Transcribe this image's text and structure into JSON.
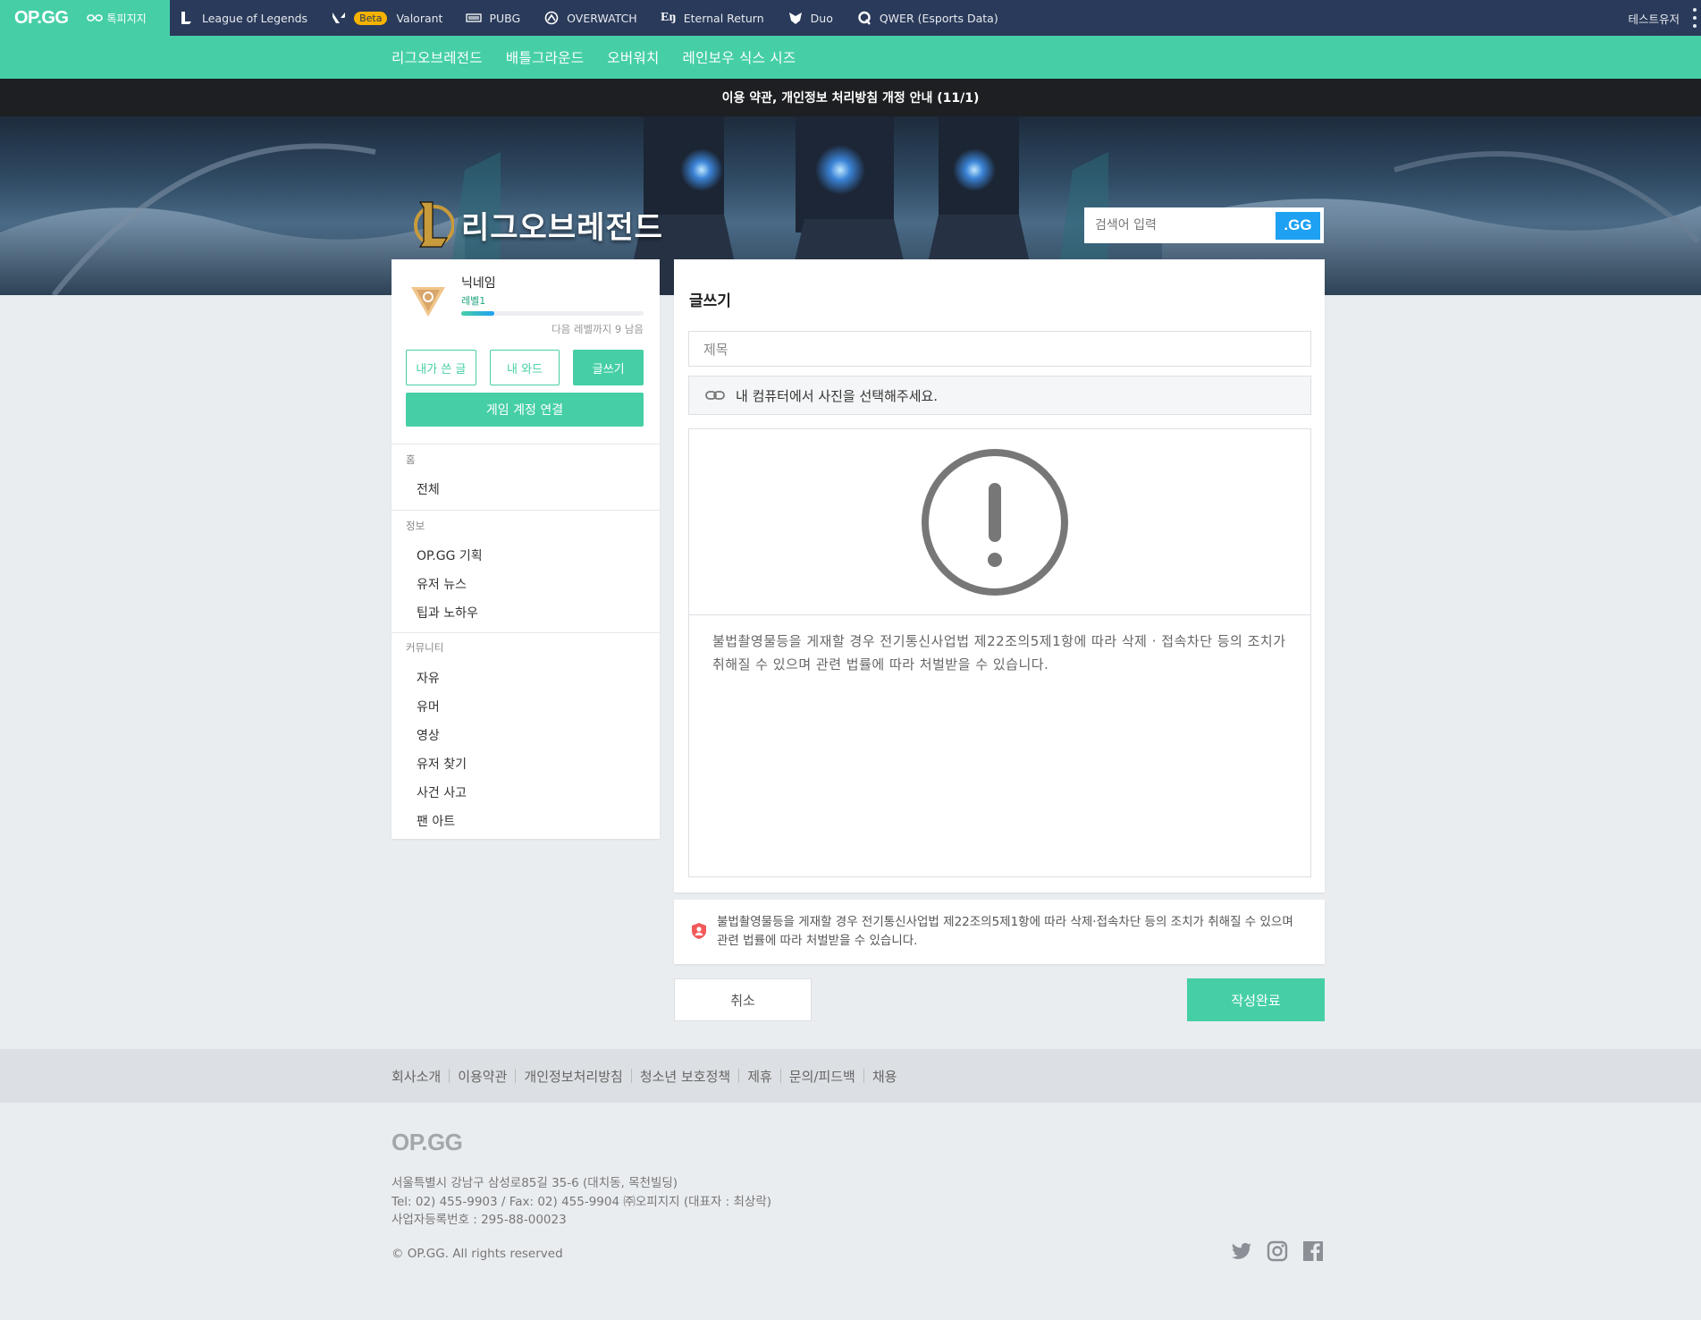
{
  "topnav": {
    "logo": "OP.GG",
    "sub_label": "톡피지지",
    "items": [
      {
        "label": "League of Legends",
        "icon": "lol-icon"
      },
      {
        "label": "Valorant",
        "icon": "valorant-icon",
        "badge": "Beta"
      },
      {
        "label": "PUBG",
        "icon": "pubg-icon"
      },
      {
        "label": "OVERWATCH",
        "icon": "overwatch-icon"
      },
      {
        "label": "Eternal Return",
        "icon": "eternal-return-icon"
      },
      {
        "label": "Duo",
        "icon": "duo-icon"
      },
      {
        "label": "QWER (Esports Data)",
        "icon": "qwer-icon"
      }
    ],
    "user": "테스트유저"
  },
  "subnav": {
    "items": [
      "리그오브레전드",
      "배틀그라운드",
      "오버워치",
      "레인보우 식스 시즈"
    ]
  },
  "notice": "이용 약관, 개인정보 처리방침 개정 안내 (11/1)",
  "banner": {
    "title": "리그오브레전드",
    "search_placeholder": "검색어 입력",
    "search_button": ".GG"
  },
  "sidebar": {
    "nickname": "닉네임",
    "level": "레벨1",
    "level_progress": 0.18,
    "next_level": "다음 레벨까지 9 남음",
    "buttons": {
      "my_posts": "내가 쓴 글",
      "my_wards": "내 와드",
      "write": "글쓰기"
    },
    "connect_button": "게임 계정 연결",
    "sections": [
      {
        "title": "홈",
        "items": [
          "전체"
        ]
      },
      {
        "title": "정보",
        "items": [
          "OP.GG 기획",
          "유저 뉴스",
          "팁과 노하우"
        ]
      },
      {
        "title": "커뮤니티",
        "items": [
          "자유",
          "유머",
          "영상",
          "유저 찾기",
          "사건 사고",
          "팬 아트"
        ]
      }
    ]
  },
  "editor": {
    "heading": "글쓰기",
    "title_placeholder": "제목",
    "photo_prompt": "내 컴퓨터에서 사진을 선택해주세요.",
    "body_notice": "불법촬영물등을 게재할 경우 전기통신사업법 제22조의5제1항에 따라 삭제 · 접속차단 등의 조치가 취해질 수 있으며 관련 법률에 따라 처벌받을 수 있습니다."
  },
  "alert": {
    "text": "불법촬영물등을 게재할 경우 전기통신사업법 제22조의5제1항에 따라 삭제·접속차단 등의 조치가 취해질 수 있으며 관련 법률에 따라 처벌받을 수 있습니다."
  },
  "actions": {
    "cancel": "취소",
    "submit": "작성완료"
  },
  "footer": {
    "links": [
      "회사소개",
      "이용약관",
      "개인정보처리방침",
      "청소년 보호정책",
      "제휴",
      "문의/피드백",
      "채용"
    ],
    "logo": "OP.GG",
    "address": "서울특별시 강남구 삼성로85길 35-6 (대치동, 목천빌딩)",
    "contact": "Tel: 02) 455-9903 / Fax: 02) 455-9904 ㈜오피지지 (대표자 : 최상락)",
    "biz_number": "사업자등록번호 : 295-88-00023",
    "copyright": "© OP.GG. All rights reserved",
    "social": [
      "twitter-icon",
      "instagram-icon",
      "facebook-icon"
    ]
  },
  "colors": {
    "accent": "#46cfa7",
    "nav_bg": "#2a3a5a",
    "gg_blue": "#1ea1f2",
    "beta": "#f5b300"
  }
}
